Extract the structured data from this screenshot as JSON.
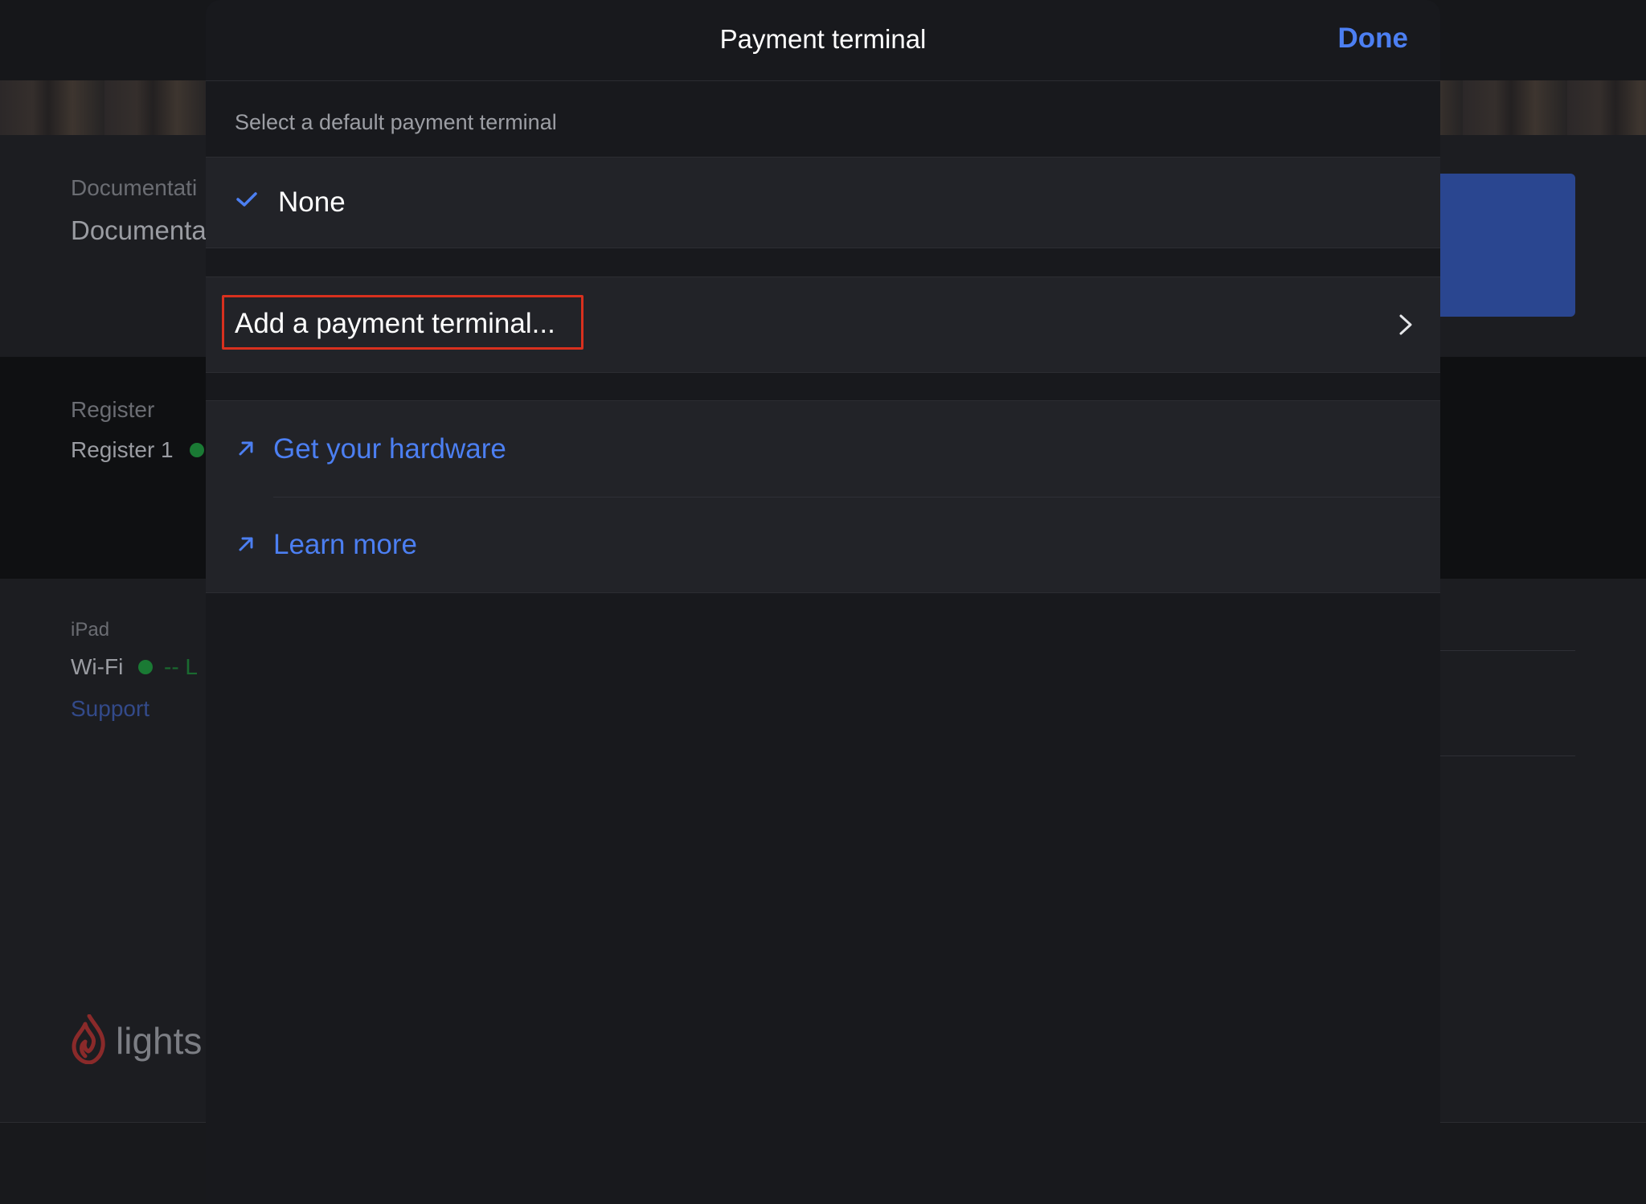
{
  "background": {
    "documentation_label": "Documentati",
    "documentation_value": "Documenta",
    "register_label": "Register",
    "register_value": "Register 1",
    "ipad_label": "iPad",
    "wifi_label": "Wi-Fi",
    "wifi_status": "-- L",
    "support_link": "Support",
    "logo_text": "lights"
  },
  "modal": {
    "title": "Payment terminal",
    "done_label": "Done",
    "section_header": "Select a default payment terminal",
    "options": {
      "none_label": "None"
    },
    "add_terminal_label": "Add a payment terminal...",
    "links": {
      "hardware_label": "Get your hardware",
      "learn_more_label": "Learn more"
    }
  },
  "colors": {
    "accent": "#4c7ff2",
    "highlight": "#d8301e",
    "status_online": "#1a7a34",
    "brand_logo": "#8a2a2a"
  },
  "icons": {
    "selected": "checkmark-icon",
    "disclosure": "chevron-right-icon",
    "external": "arrow-up-right-icon"
  }
}
